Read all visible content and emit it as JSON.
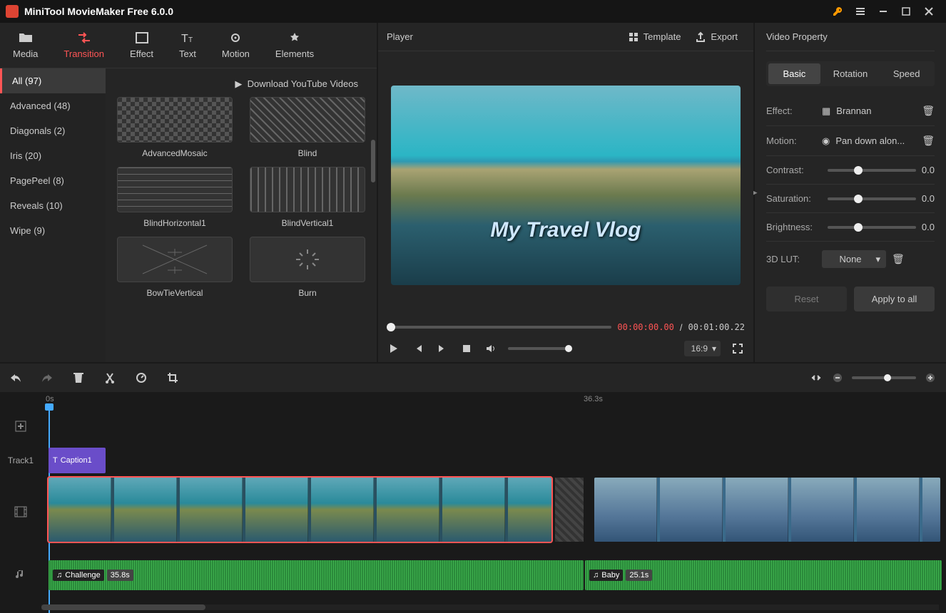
{
  "app": {
    "title": "MiniTool MovieMaker Free 6.0.0"
  },
  "top_tabs": [
    {
      "id": "media",
      "label": "Media"
    },
    {
      "id": "transition",
      "label": "Transition",
      "active": true
    },
    {
      "id": "effect",
      "label": "Effect"
    },
    {
      "id": "text",
      "label": "Text"
    },
    {
      "id": "motion",
      "label": "Motion"
    },
    {
      "id": "elements",
      "label": "Elements"
    }
  ],
  "categories": [
    {
      "label": "All (97)",
      "active": true
    },
    {
      "label": "Advanced (48)"
    },
    {
      "label": "Diagonals (2)"
    },
    {
      "label": "Iris (20)"
    },
    {
      "label": "PagePeel (8)"
    },
    {
      "label": "Reveals (10)"
    },
    {
      "label": "Wipe (9)"
    }
  ],
  "download_link": "Download YouTube Videos",
  "transitions": [
    {
      "name": "AdvancedMosaic"
    },
    {
      "name": "Blind"
    },
    {
      "name": "BlindHorizontal1"
    },
    {
      "name": "BlindVertical1"
    },
    {
      "name": "BowTieVertical"
    },
    {
      "name": "Burn"
    }
  ],
  "player": {
    "title": "Player",
    "template_btn": "Template",
    "export_btn": "Export",
    "caption": "My Travel Vlog",
    "time_current": "00:00:00.00",
    "time_total": "00:01:00.22",
    "ratio": "16:9"
  },
  "props": {
    "title": "Video Property",
    "tabs": [
      "Basic",
      "Rotation",
      "Speed"
    ],
    "effect_label": "Effect:",
    "effect_value": "Brannan",
    "motion_label": "Motion:",
    "motion_value": "Pan down alon...",
    "contrast_label": "Contrast:",
    "contrast_value": "0.0",
    "saturation_label": "Saturation:",
    "saturation_value": "0.0",
    "brightness_label": "Brightness:",
    "brightness_value": "0.0",
    "lut_label": "3D LUT:",
    "lut_value": "None",
    "reset_btn": "Reset",
    "apply_btn": "Apply to all"
  },
  "timeline": {
    "ruler_marks": [
      "0s",
      "36.3s"
    ],
    "track1_label": "Track1",
    "caption_clip": "Caption1",
    "audio1_name": "Challenge",
    "audio1_dur": "35.8s",
    "audio2_name": "Baby",
    "audio2_dur": "25.1s"
  }
}
